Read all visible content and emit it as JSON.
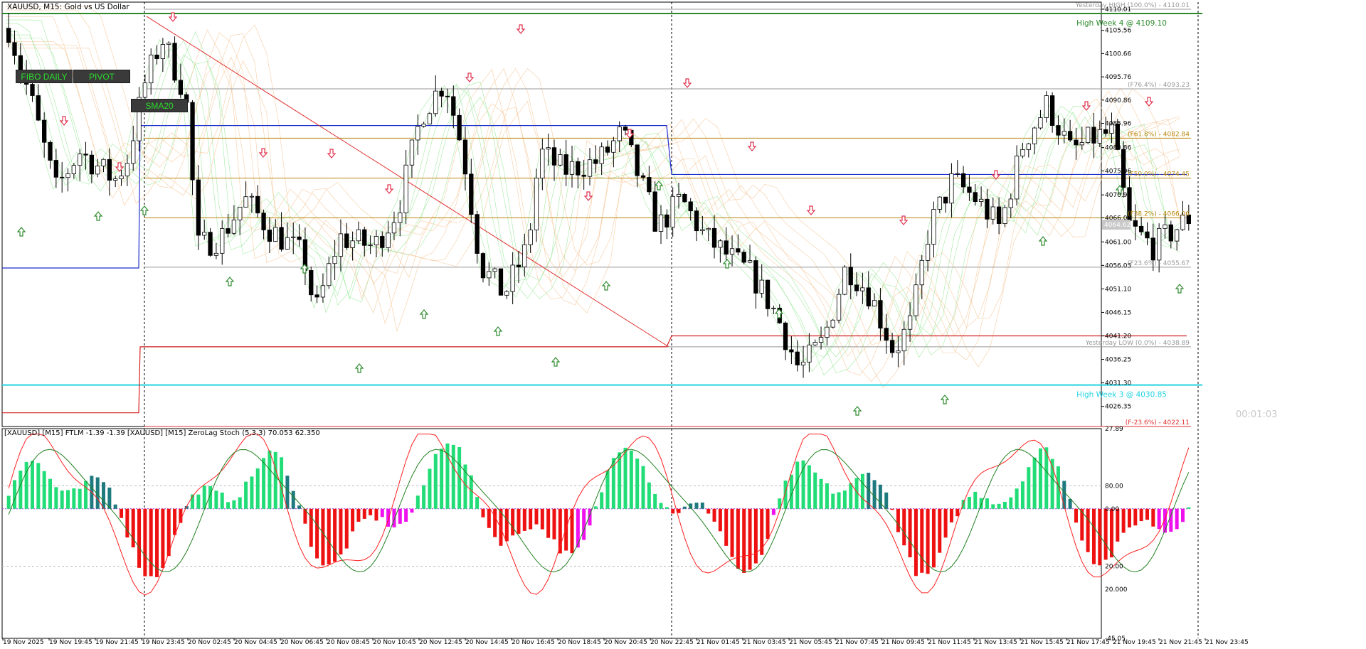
{
  "window": {
    "title": "XAUUSD, M15:  Gold vs US Dollar",
    "timer": "00:01:03"
  },
  "buttons": {
    "fibo_daily": "FIBO DAILY",
    "pivot": "PIVOT",
    "sma20": "SMA20"
  },
  "colors": {
    "bull": "#2a2a2a",
    "bear": "#000000",
    "green_arrow": "#2e8b2e",
    "red_arrow": "#e0304e",
    "fib": "#b8860b",
    "trend": "#e03030",
    "hist_bull": "#22dd77",
    "hist_bull_dark": "#1f7a80",
    "hist_bear": "#ee1111",
    "hist_bear_mag": "#ee11ee",
    "osc_red": "#ff2020",
    "osc_green": "#208020"
  },
  "chart_data": [
    {
      "type": "candlestick",
      "title": "XAUUSD, M15:  Gold vs US Dollar",
      "ylim": [
        4022.11,
        4111.5
      ],
      "price_ticks": [
        "4110.01",
        "4105.56",
        "4100.66",
        "4095.76",
        "4090.86",
        "4085.96",
        "4080.86",
        "4075.96",
        "4070.90",
        "4066.06",
        "4061.00",
        "4056.05",
        "4051.10",
        "4046.15",
        "4041.20",
        "4036.25",
        "4031.30",
        "4026.35"
      ],
      "time_labels": [
        "19 Nov 2025",
        "19 Nov 19:45",
        "19 Nov 21:45",
        "19 Nov 23:45",
        "20 Nov 02:45",
        "20 Nov 04:45",
        "20 Nov 06:45",
        "20 Nov 08:45",
        "20 Nov 10:45",
        "20 Nov 12:45",
        "20 Nov 14:45",
        "20 Nov 16:45",
        "20 Nov 18:45",
        "20 Nov 20:45",
        "20 Nov 22:45",
        "21 Nov 01:45",
        "21 Nov 03:45",
        "21 Nov 05:45",
        "21 Nov 07:45",
        "21 Nov 09:45",
        "21 Nov 11:45",
        "21 Nov 13:45",
        "21 Nov 15:45",
        "21 Nov 17:45",
        "21 Nov 19:45",
        "21 Nov 21:45",
        "21 Nov 23:45"
      ],
      "current_price": "4064.62",
      "levels": [
        {
          "label": "Yesterday HIGH (100.0%) - 4110.01",
          "value": 4110.01,
          "color": "#999999"
        },
        {
          "label": "(F76.4%) - 4093.23",
          "value": 4093.23,
          "color": "#999999"
        },
        {
          "label": "(F61.8%) - 4082.84",
          "value": 4082.84,
          "color": "#b8860b"
        },
        {
          "label": "(F50.0%) - 4074.45",
          "value": 4074.45,
          "color": "#b8860b"
        },
        {
          "label": "(F38.2%) - 4066.06",
          "value": 4066.06,
          "color": "#b8860b"
        },
        {
          "label": "(F23.6%) - 4055.67",
          "value": 4055.67,
          "color": "#999999"
        },
        {
          "label": "Yesterday LOW (0.0%) - 4038.89",
          "value": 4038.89,
          "color": "#999999"
        },
        {
          "label": "(F-23.6%) - 4022.11",
          "value": 4022.11,
          "color": "#e03030"
        }
      ],
      "weekly": [
        {
          "label": "High Week 4 @ 4109.10",
          "value": 4109.1,
          "color": "#2a8a2a"
        },
        {
          "label": "High Week 3 @ 4030.85",
          "value": 4030.85,
          "color": "#22d3e0"
        }
      ]
    },
    {
      "type": "bar",
      "title": "[XAUUSD] [M15] FTLM -1.39 -1.39 [XAUUSD] [M15] ZeroLag Stoch (5,3,3) 70.053 62.350",
      "ylim": [
        -45.05,
        27.89
      ],
      "ticks": [
        "27.89",
        "80.00",
        "0.00",
        "20.00",
        "20.000",
        "-45.05"
      ]
    }
  ]
}
